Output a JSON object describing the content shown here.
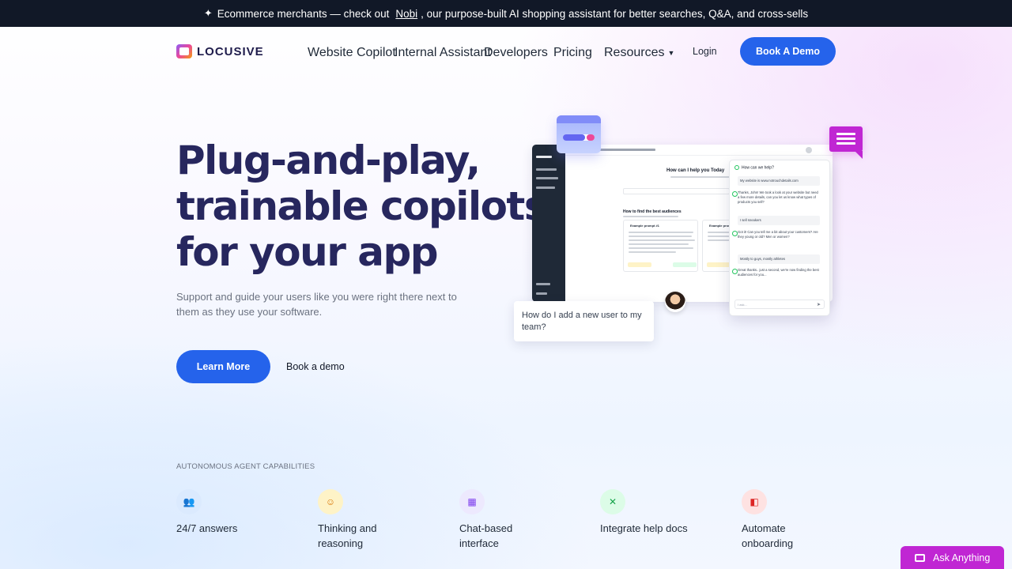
{
  "announcement": {
    "icon": "sparkle-icon",
    "prefix": "Ecommerce merchants — check out",
    "link": "Nobi",
    "suffix": ", our purpose-built AI shopping assistant for better searches, Q&A, and cross-sells"
  },
  "nav": {
    "logo": "LOCUSIVE",
    "links": [
      "Website Copilot",
      "Internal Assistant",
      "Developers",
      "Pricing",
      "Resources"
    ],
    "login": "Login",
    "cta": "Book A Demo"
  },
  "hero": {
    "title_lines": [
      "Plug-and-play,",
      "trainable copilots",
      "for your app"
    ],
    "subtitle": "Support and guide your users like you were right there next to them as they use your software.",
    "primary_cta": "Learn More",
    "secondary_cta": "Book a demo"
  },
  "illustration": {
    "app_heading": "How can I help you Today",
    "section_heading": "How to find the best audiences",
    "card_titles": [
      "Example prompt #1",
      "Example prompt"
    ],
    "chat_title": "How can we help?",
    "messages": [
      {
        "role": "user",
        "text": "My website is www.notrouchdetails.com"
      },
      {
        "role": "bot",
        "text": "Thanks, John! We took a look at your website but need a few more details, can you let us know what types of products you sell?"
      },
      {
        "role": "user",
        "text": "I sell sneakers"
      },
      {
        "role": "bot",
        "text": "Got it! Can you tell me a bit about your customers? Are they young or old? Men or women?"
      },
      {
        "role": "user",
        "text": "Mostly to guys, mostly athletes"
      },
      {
        "role": "bot",
        "text": "Great thanks.. just a second, we're now finding the best audiences for you..."
      }
    ],
    "chat_input_placeholder": "I ask...",
    "question": "How do I add a new user to my team?"
  },
  "capabilities": {
    "label": "AUTONOMOUS AGENT CAPABILITIES",
    "items": [
      {
        "label": "24/7 answers",
        "icon": "users-icon",
        "bg": "#dbeafe",
        "fg": "#2563eb"
      },
      {
        "label": "Thinking and reasoning",
        "icon": "person-icon",
        "bg": "#fef3c7",
        "fg": "#d97706"
      },
      {
        "label": "Chat-based interface",
        "icon": "chat-icon",
        "bg": "#ede9fe",
        "fg": "#7c3aed"
      },
      {
        "label": "Integrate help docs",
        "icon": "tools-icon",
        "bg": "#dcfce7",
        "fg": "#16a34a"
      },
      {
        "label": "Automate onboarding",
        "icon": "toggle-icon",
        "bg": "#fee2e2",
        "fg": "#dc2626"
      }
    ]
  },
  "ask": {
    "label": "Ask Anything"
  },
  "colors": {
    "primary": "#2563eb",
    "title": "#27275e",
    "accent": "#c026d3",
    "announce_bg": "#111827"
  }
}
